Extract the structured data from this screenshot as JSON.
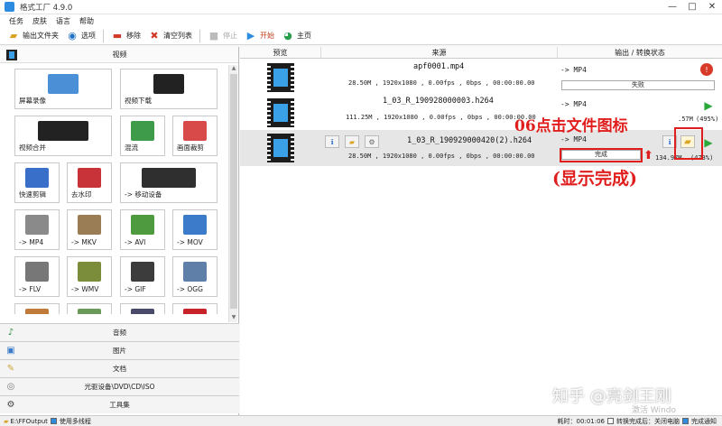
{
  "window": {
    "title": "格式工厂 4.9.0",
    "buttons": [
      "—",
      "□",
      "✕"
    ]
  },
  "menu": [
    "任务",
    "皮肤",
    "语言",
    "帮助"
  ],
  "toolbar": {
    "output_folder": "输出文件夹",
    "options": "选项",
    "remove": "移除",
    "clear_list": "清空列表",
    "stop": "停止",
    "start": "开始",
    "home": "主页"
  },
  "left": {
    "category_video": "视频",
    "tiles": [
      {
        "label": "屏幕录像",
        "icon": "screen-record-icon"
      },
      {
        "label": "视频下载",
        "icon": "video-download-icon"
      },
      {
        "label": "视频合并",
        "icon": "video-merge-icon"
      },
      {
        "label": "混流",
        "icon": "mux-icon"
      },
      {
        "label": "画面裁剪",
        "icon": "crop-icon"
      },
      {
        "label": "快速剪辑",
        "icon": "quick-clip-icon"
      },
      {
        "label": "去水印",
        "icon": "remove-watermark-icon"
      },
      {
        "label": "-> 移动设备",
        "icon": "mobile-device-icon"
      },
      {
        "label": "-> MP4",
        "icon": "mp4-icon"
      },
      {
        "label": "-> MKV",
        "icon": "mkv-icon"
      },
      {
        "label": "-> AVI",
        "icon": "avi-icon"
      },
      {
        "label": "-> MOV",
        "icon": "mov-icon"
      },
      {
        "label": "-> FLV",
        "icon": "flv-icon"
      },
      {
        "label": "-> WMV",
        "icon": "wmv-icon"
      },
      {
        "label": "-> GIF",
        "icon": "gif-icon"
      },
      {
        "label": "-> OGG",
        "icon": "ogg-icon"
      },
      {
        "label": "",
        "icon": "format-icon"
      },
      {
        "label": "",
        "icon": "format-icon"
      },
      {
        "label": "",
        "icon": "format-icon"
      },
      {
        "label": "",
        "icon": "flash-icon"
      }
    ],
    "categories": [
      "音频",
      "图片",
      "文档",
      "光驱设备\\DVD\\CD\\ISO",
      "工具集"
    ]
  },
  "table": {
    "headers": [
      "预览",
      "来源",
      "输出 / 转换状态"
    ],
    "rows": [
      {
        "name": "apf0001.mp4",
        "meta": "28.50M ,  1920x1080 ,  0.00fps ,  0bps  ,  00:00:00.00",
        "output": "-> MP4",
        "status": "失败",
        "size": "",
        "percent": ""
      },
      {
        "name": "1_03_R_190928000003.h264",
        "meta": "111.25M ,  1920x1080 ,  0.00fps ,  0bps  ,  00:00:00.00",
        "output": "-> MP4",
        "status": "",
        "size": ".57M",
        "percent": "(495%)"
      },
      {
        "name": "1_03_R_190929000420(2).h264",
        "meta": "28.50M ,  1920x1080 ,  0.00fps ,  0bps  ,  00:00:00.00",
        "output": "-> MP4",
        "status": "完成",
        "size": "134.97M",
        "percent": "(473%)"
      }
    ]
  },
  "annotation": {
    "step": "06点击文件图标",
    "note": "(显示完成)",
    "arrow": "⬆"
  },
  "statusbar": {
    "output_path": "E:\\FFOutput",
    "multithread": "使用多线程",
    "elapsed_label": "耗时：",
    "elapsed": "00:01:06",
    "after_convert": "转换完成后：关闭电脑",
    "notify": "完成通知"
  },
  "watermark": "知乎 @亮剑王刚",
  "windows_activation": "激活 Windo"
}
